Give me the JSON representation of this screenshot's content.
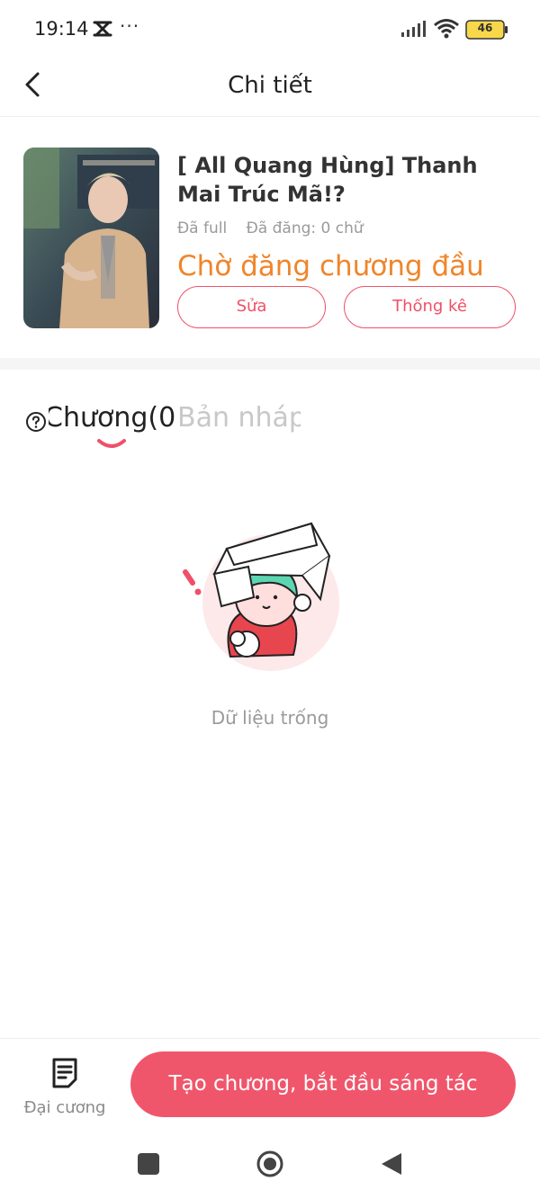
{
  "status_bar": {
    "time": "19:14",
    "more": "···",
    "battery_label": "46",
    "icons": [
      "capcut-icon",
      "signal-icon",
      "wifi-icon",
      "battery-icon"
    ]
  },
  "header": {
    "title": "Chi tiết",
    "back_icon": "chevron-left-icon"
  },
  "book": {
    "title": "[ All Quang Hùng] Thanh Mai Trúc Mã!?",
    "completion": "Đã full",
    "posted": "Đã đăng: 0 chữ",
    "status": "Chờ đăng chương đầu",
    "edit_label": "Sửa",
    "stats_label": "Thống kê"
  },
  "tabs": {
    "chapters_label": "Chương(0",
    "draft_label": "Bản nháp",
    "active": "chapters"
  },
  "empty_state": {
    "text": "Dữ liệu trống"
  },
  "bottom_bar": {
    "outline_label": "Đại cương",
    "create_label": "Tạo chương, bắt đầu sáng tác"
  },
  "colors": {
    "accent": "#ef5068",
    "status_orange": "#f0852a",
    "muted_text": "#9a9a9a"
  }
}
